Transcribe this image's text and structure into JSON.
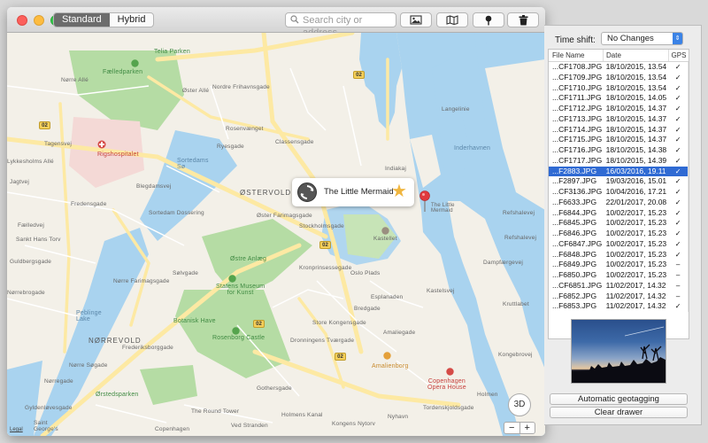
{
  "toolbar": {
    "map_modes": [
      "Standard",
      "Hybrid"
    ],
    "selected_mode": "Standard",
    "search_placeholder": "Search city or address",
    "buttons": [
      "photo-icon",
      "map-icon",
      "pin-icon",
      "trash-icon"
    ]
  },
  "map": {
    "callout": {
      "title": "The Little Mermaid"
    },
    "labels": {
      "telia": "Telia Parken",
      "faelled": "Fælledparken",
      "riges": "Rigshospitalet",
      "sortedams": "Sortedams\nSø",
      "osterbro_label": "ØSTERVOLD",
      "kastellet": "Kastellet",
      "ostre_anlaeg": "Østre Anlæg",
      "statens": "Statens Museum\nfor Kunst",
      "botanisk": "Botanisk Have",
      "rosenborg": "Rosenborg Castle",
      "norrevold": "NØRREVOLD",
      "peblinge": "Peblinge\nLake",
      "amalienborg": "Amalienborg",
      "opera": "Copenhagen\nOpera House",
      "inderhavnen": "Inderhavnen",
      "refshaleoen": "Refshalevej",
      "orstedsparken": "Ørstedsparken",
      "round_tower": "The Round Tower",
      "copenhagen": "Copenhagen",
      "gothersgade": "Gothersgade",
      "little_mermaid_small": "The Little\nMermaid",
      "kongebrovej": "Kongebrovej",
      "kruttlabet": "Kruttlabet",
      "st_georges": "Saint\nGeorge's",
      "nordre_frihavnsgade": "Nordre Frihavnsgade",
      "classensgade": "Classensgade",
      "oster_alle": "Øster Allé",
      "tagensvej": "Tagensvej",
      "norre_alle": "Nørre Allé",
      "faelledvej": "Fælledvej",
      "gyldenlovesgade": "Gyldenløvesgade",
      "langelinie": "Langelinie",
      "kastelsvej": "Kastelsvej",
      "esplanaden": "Esplanaden",
      "indiakaj": "Indiakaj",
      "dampfaergevej": "Dampfærgevej",
      "refshalevej_road": "Refshalevej",
      "rosenvaenget": "Rosenvænget",
      "oslo_plads": "Oslo Plads",
      "holmen": "Holmen",
      "ryesgade": "Ryesgade",
      "blegdamsvej": "Blegdamsvej",
      "guldbergsgade": "Guldbergsgade",
      "fredensgade": "Fredensgade",
      "sortedam_dossering": "Sortedam Dossering",
      "solvgade": "Sølvgade",
      "kronprinsessegade": "Kronprinsessegade",
      "stockholmsgade": "Stockholmsgade",
      "oster_farimagsgade": "Øster Farimagsgade",
      "norre_farimagsgade": "Nørre Farimagsgade",
      "frederiksborggade": "Frederiksborggade",
      "store_kongensgade": "Store Kongensgade",
      "bredgade": "Bredgade",
      "amaliegade": "Amaliegade",
      "dronningens_tvaergade": "Dronningens Tværgade",
      "norregade": "Nørregade",
      "kongens_nytorv": "Kongens Nytorv",
      "faelledparken_x": "Fælledparken",
      "jagtvej": "Jagtvej",
      "lykkesholms": "Lykkesholms Allé",
      "norrebrogade": "Nørrebrogade",
      "sankt_hans": "Sankt Hans Torv",
      "norre_sogade": "Nørre Søgade",
      "ved_stranden": "Ved Stranden",
      "nyhavn": "Nyhavn",
      "tordenskjoldsgade": "Tordenskjoldsgade",
      "holmens_kanal": "Holmens Kanal"
    },
    "badge_label": "02",
    "zoom_minus": "−",
    "zoom_plus": "+",
    "three_d": "3D",
    "legal": "Legal"
  },
  "drawer": {
    "time_shift_label": "Time shift:",
    "time_shift_value": "No Changes",
    "columns": [
      "File Name",
      "Date",
      "GPS"
    ],
    "rows": [
      {
        "file": "...CF1708.JPG",
        "date": "18/10/2015, 13.54",
        "gps": "✓"
      },
      {
        "file": "...CF1709.JPG",
        "date": "18/10/2015, 13.54",
        "gps": "✓"
      },
      {
        "file": "...CF1710.JPG",
        "date": "18/10/2015, 13.54",
        "gps": "✓"
      },
      {
        "file": "...CF1711.JPG",
        "date": "18/10/2015, 14.05",
        "gps": "✓"
      },
      {
        "file": "...CF1712.JPG",
        "date": "18/10/2015, 14.37",
        "gps": "✓"
      },
      {
        "file": "...CF1713.JPG",
        "date": "18/10/2015, 14.37",
        "gps": "✓"
      },
      {
        "file": "...CF1714.JPG",
        "date": "18/10/2015, 14.37",
        "gps": "✓"
      },
      {
        "file": "...CF1715.JPG",
        "date": "18/10/2015, 14.37",
        "gps": "✓"
      },
      {
        "file": "...CF1716.JPG",
        "date": "18/10/2015, 14.38",
        "gps": "✓"
      },
      {
        "file": "...CF1717.JPG",
        "date": "18/10/2015, 14.39",
        "gps": "✓"
      },
      {
        "file": "...F2883.JPG",
        "date": "16/03/2016, 19.11",
        "gps": "✓"
      },
      {
        "file": "...F2897.JPG",
        "date": "19/03/2016, 15.01",
        "gps": "✓"
      },
      {
        "file": "...CF3136.JPG",
        "date": "10/04/2016, 17.21",
        "gps": "✓"
      },
      {
        "file": "...F6633.JPG",
        "date": "22/01/2017, 20.08",
        "gps": "✓"
      },
      {
        "file": "...F6844.JPG",
        "date": "10/02/2017, 15.23",
        "gps": "✓"
      },
      {
        "file": "...F6845.JPG",
        "date": "10/02/2017, 15.23",
        "gps": "✓"
      },
      {
        "file": "...F6846.JPG",
        "date": "10/02/2017, 15.23",
        "gps": "✓"
      },
      {
        "file": "...CF6847.JPG",
        "date": "10/02/2017, 15.23",
        "gps": "✓"
      },
      {
        "file": "...F6848.JPG",
        "date": "10/02/2017, 15.23",
        "gps": "✓"
      },
      {
        "file": "...F6849.JPG",
        "date": "10/02/2017, 15.23",
        "gps": "–"
      },
      {
        "file": "...F6850.JPG",
        "date": "10/02/2017, 15.23",
        "gps": "–"
      },
      {
        "file": "...CF6851.JPG",
        "date": "11/02/2017, 14.32",
        "gps": "–"
      },
      {
        "file": "...F6852.JPG",
        "date": "11/02/2017, 14.32",
        "gps": "–"
      },
      {
        "file": "...F6853.JPG",
        "date": "11/02/2017, 14.32",
        "gps": "✓"
      }
    ],
    "selected_row": 10,
    "auto_button": "Automatic geotagging",
    "clear_button": "Clear drawer"
  }
}
